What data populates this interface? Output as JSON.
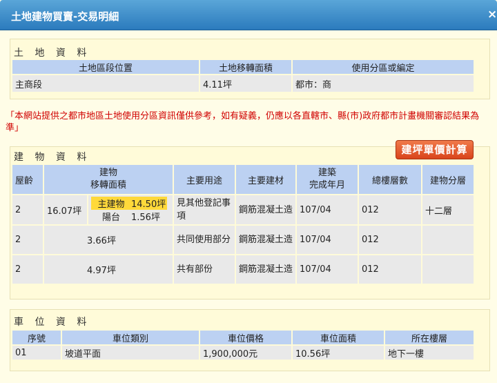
{
  "window": {
    "title": "土地建物買賣-交易明細",
    "close": "×"
  },
  "land": {
    "section_title": "土 地 資 料",
    "headers": [
      "土地區段位置",
      "土地移轉面積",
      "使用分區或編定"
    ],
    "rows": [
      [
        "主商段",
        "4.11坪",
        "都市：商"
      ]
    ]
  },
  "notice": "「本網站提供之都市地區土地使用分區資訊僅供參考，如有疑義，仍應以各直轄市、縣(市)政府都市計畫機關審認結果為準」",
  "building": {
    "section_title": "建 物 資 料",
    "calc_button": "建坪單價計算",
    "headers": [
      "屋齡",
      "建物",
      "移轉面積",
      "主要用途",
      "主要建材",
      "建築",
      "完成年月",
      "總樓層數",
      "建物分層"
    ],
    "row1": {
      "age": "2",
      "total": "16.07坪",
      "main_label": "主建物",
      "main_area": "14.50坪",
      "balcony_label": "陽台",
      "balcony_area": "1.56坪",
      "use": "見其他登記事項",
      "material": "鋼筋混凝土造",
      "date": "107/04",
      "floors": "012",
      "layer": "十二層"
    },
    "row2": {
      "age": "2",
      "area": "3.66坪",
      "use": "共同使用部分",
      "material": "鋼筋混凝土造",
      "date": "107/04",
      "floors": "012",
      "layer": ""
    },
    "row3": {
      "age": "2",
      "area": "4.97坪",
      "use": "共有部份",
      "material": "鋼筋混凝土造",
      "date": "107/04",
      "floors": "012",
      "layer": ""
    }
  },
  "parking": {
    "section_title": "車 位 資 料",
    "headers": [
      "序號",
      "車位類別",
      "車位價格",
      "車位面積",
      "所在樓層"
    ],
    "rows": [
      [
        "01",
        "坡道平面",
        "1,900,000元",
        "10.56坪",
        "地下一樓"
      ]
    ]
  }
}
